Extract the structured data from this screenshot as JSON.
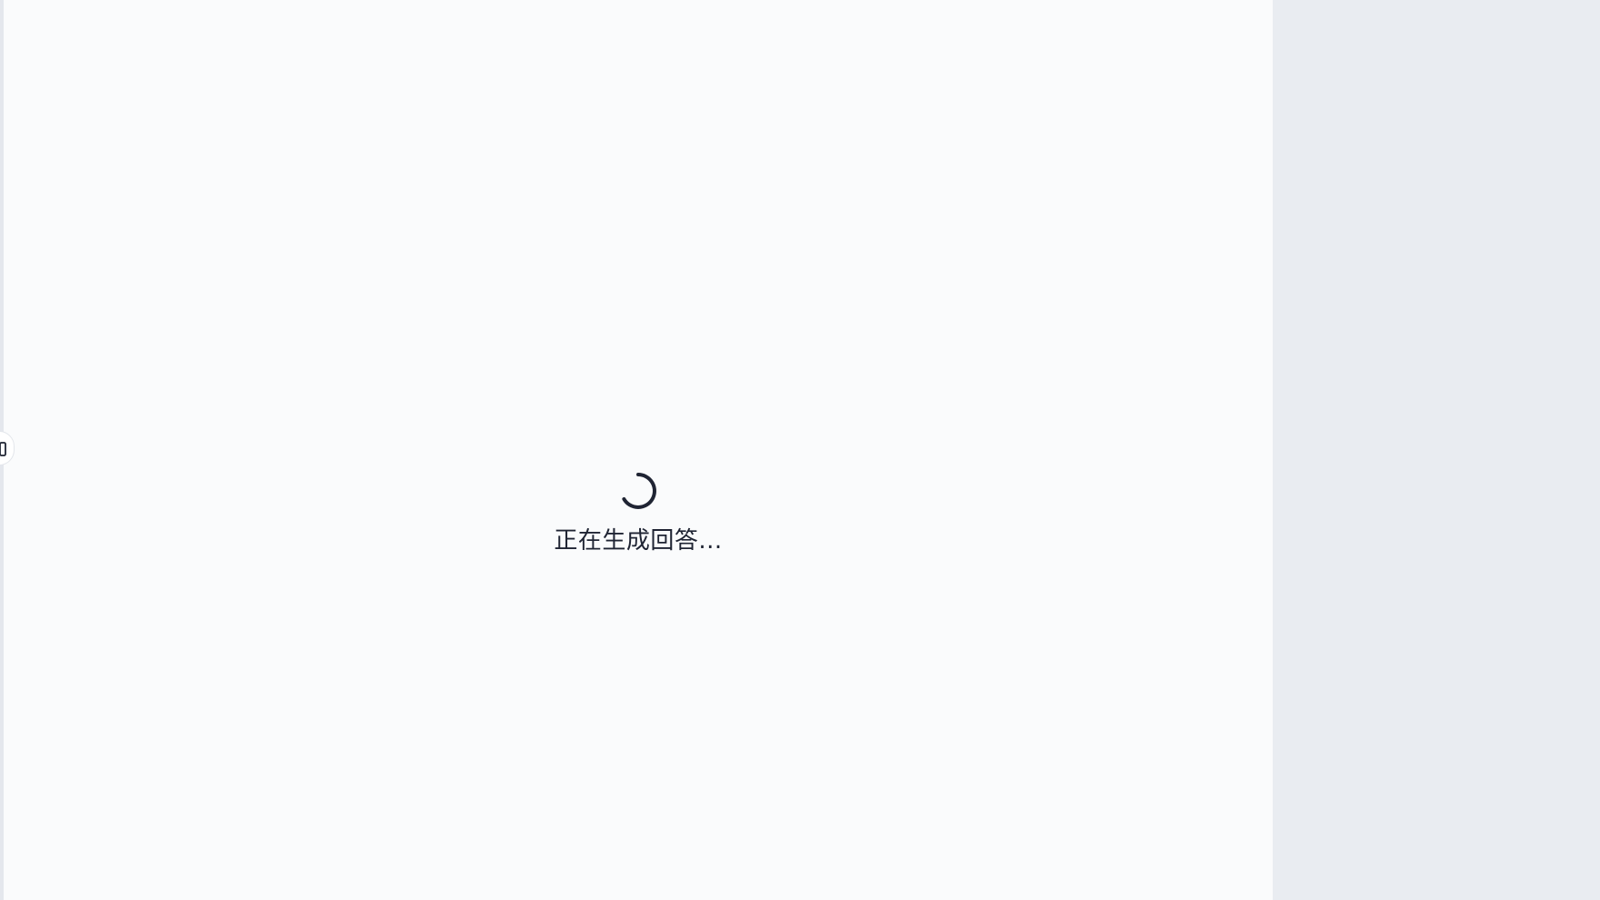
{
  "status": {
    "loading_text": "正在生成回答..."
  },
  "colors": {
    "panel_background": "#fafbfc",
    "side_background": "#e9ecf1",
    "text": "#1f2433",
    "spinner": "#1f2433"
  },
  "icons": {
    "spinner": "loading-spinner-icon",
    "handle": "sidebar-collapse-icon"
  }
}
